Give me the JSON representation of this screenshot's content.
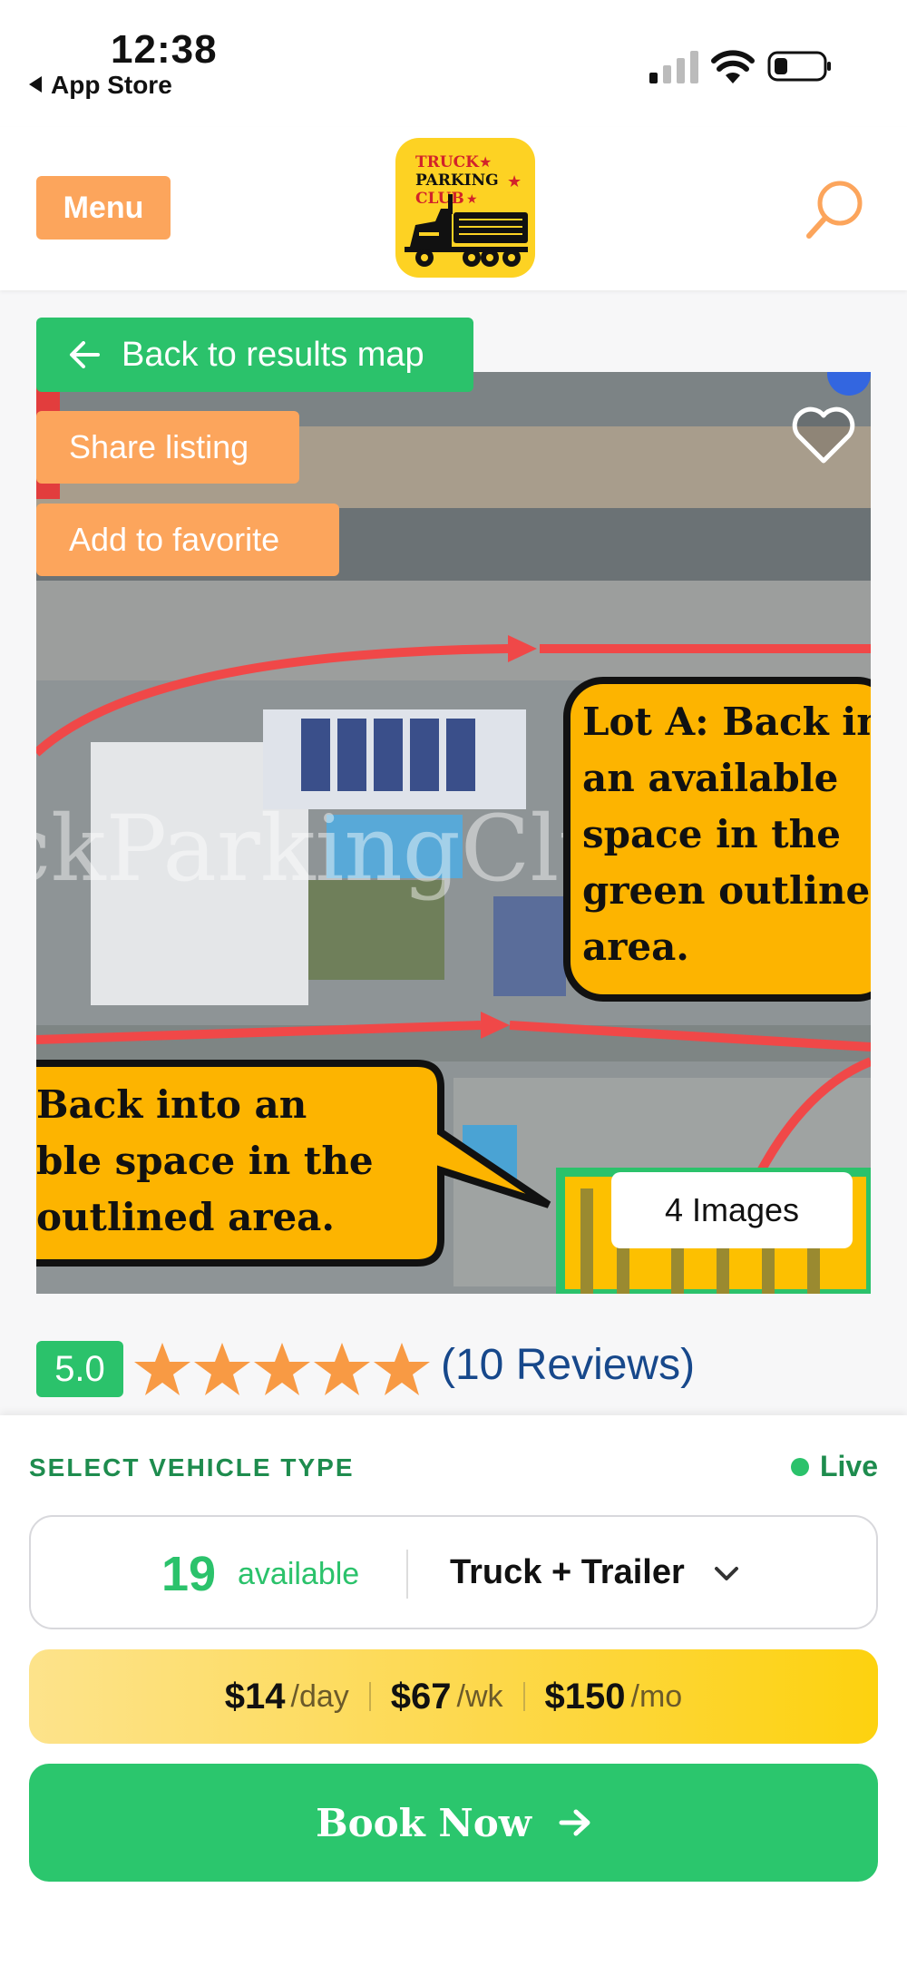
{
  "status_bar": {
    "time": "12:38",
    "back_label": "App Store"
  },
  "header": {
    "menu_label": "Menu",
    "logo_lines": [
      "TRUCK",
      "PARKING",
      "CLUB"
    ]
  },
  "listing": {
    "back_label": "Back to results map",
    "share_label": "Share listing",
    "favorite_label": "Add to favorite",
    "image_count": "4 Images",
    "photo_callouts": {
      "lot_a": [
        "Lot A: Back int",
        "an available",
        "space in the",
        "green outlined",
        "area."
      ],
      "lot_b": [
        "Back into an",
        "ble space in the",
        "outlined area."
      ],
      "watermark": "ckParkingClub.c"
    },
    "rating": {
      "score": "5.0",
      "stars": 5,
      "reviews": "(10 Reviews)"
    }
  },
  "booking": {
    "select_label": "SELECT VEHICLE TYPE",
    "live_label": "Live",
    "available_count": "19",
    "available_label": "available",
    "vehicle_type": "Truck + Trailer",
    "prices": [
      {
        "amount": "$14",
        "unit": "/day"
      },
      {
        "amount": "$67",
        "unit": "/wk"
      },
      {
        "amount": "$150",
        "unit": "/mo"
      }
    ],
    "book_label": "Book Now"
  },
  "colors": {
    "green": "#2bc26b",
    "orange": "#fca55c",
    "yellow": "#fdd20f",
    "link_blue": "#17488b"
  }
}
